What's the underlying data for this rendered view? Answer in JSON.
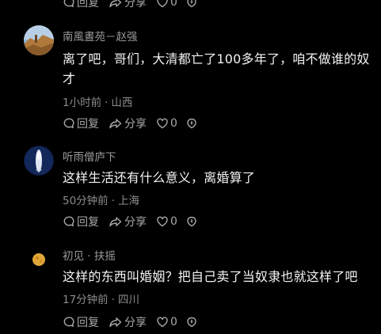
{
  "actions": {
    "reply": "回复",
    "share": "分享",
    "like_count": "0"
  },
  "comments": [
    {
      "author": "南風晝苑－赵强",
      "content": "离了吧，哥们，大清都亡了100多年了，咱不做谁的奴才",
      "time": "1小时前",
      "location": "山西"
    },
    {
      "author": "听雨僧庐下",
      "content": "这样生活还有什么意义，离婚算了",
      "time": "50分钟前",
      "location": "上海"
    },
    {
      "author": "初见 · 扶摇",
      "content": "这样的东西叫婚姻？把自己卖了当奴隶也就这样了吧",
      "time": "17分钟前",
      "location": "四川"
    }
  ],
  "colors": {
    "background": "#000000",
    "text_primary": "#f2f2f2",
    "text_secondary": "#8c8c8c",
    "icon": "#a8a8a8"
  }
}
